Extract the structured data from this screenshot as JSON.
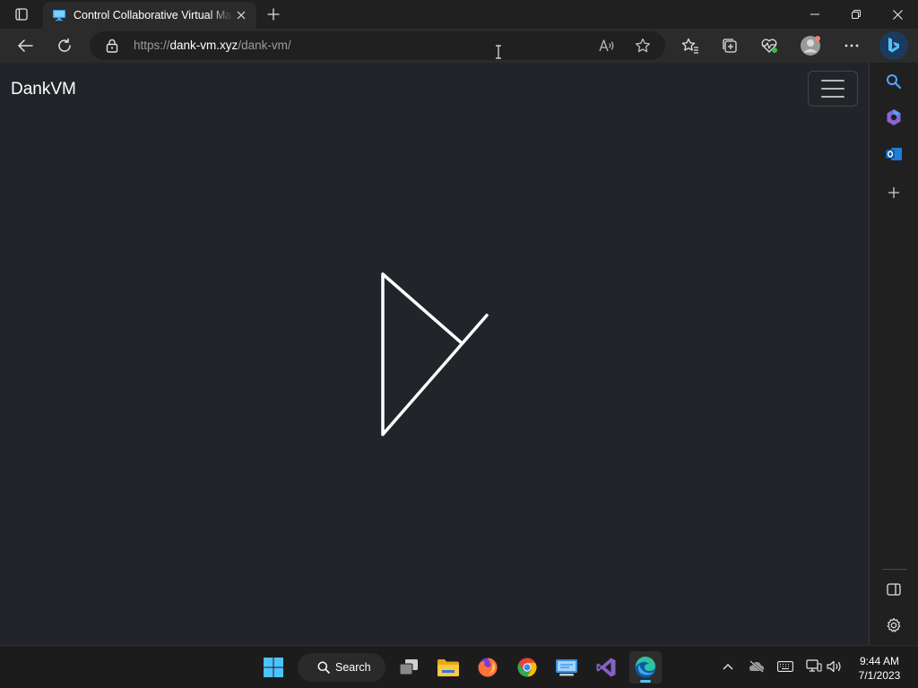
{
  "browser": {
    "tab": {
      "title": "Control Collaborative Virtual Machine"
    },
    "address": {
      "scheme": "https://",
      "host": "dank-vm.xyz",
      "path": "/dank-vm/"
    }
  },
  "page": {
    "brand": "DankVM"
  },
  "taskbar": {
    "search_label": "Search",
    "time": "9:44 AM",
    "date": "7/1/2023",
    "apps": [
      "windows-start",
      "task-view",
      "file-explorer",
      "firefox",
      "chrome",
      "remote-desktop",
      "visual-studio",
      "edge"
    ]
  },
  "colors": {
    "page_background": "#212529",
    "accent": "#4cc2ff",
    "vm_glyph": "#ffffff"
  }
}
